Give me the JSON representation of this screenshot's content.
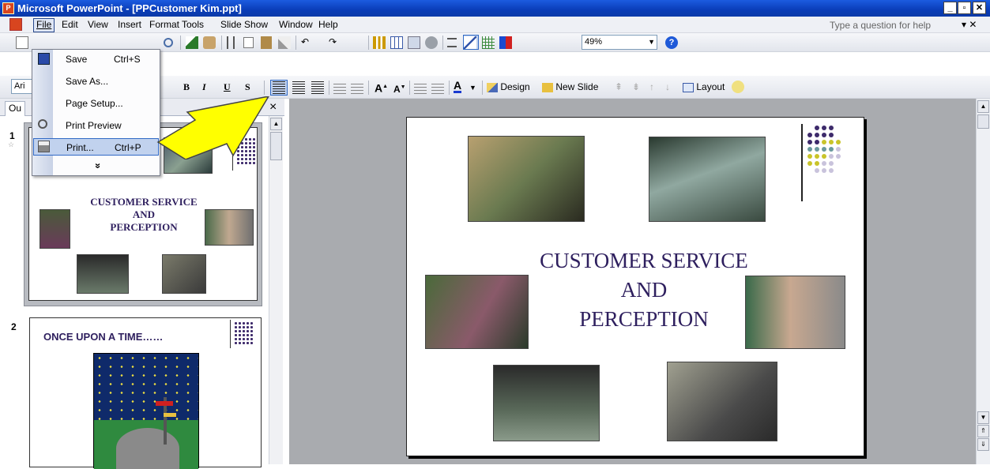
{
  "titlebar": {
    "title": "Microsoft PowerPoint - [PPCustomer  Kim.ppt]",
    "min": "_",
    "restore": "▫",
    "close": "✕"
  },
  "menubar": {
    "items": [
      "File",
      "Edit",
      "View",
      "Insert",
      "Format",
      "Tools",
      "Slide Show",
      "Window",
      "Help"
    ],
    "help_placeholder": "Type a question for help",
    "close_doc": "▾ ✕"
  },
  "toolbar_standard": {
    "zoom": "49%"
  },
  "toolbar_formatting": {
    "font_partial": "Ari",
    "bold": "B",
    "italic": "I",
    "underline": "U",
    "shadow": "S",
    "design": "Design",
    "new_slide": "New Slide",
    "layout": "Layout"
  },
  "outline_tabs": {
    "outline_partial": "Ou",
    "close": "×"
  },
  "file_menu": {
    "items": [
      {
        "label": "Save",
        "shortcut": "Ctrl+S"
      },
      {
        "label": "Save As...",
        "shortcut": ""
      },
      {
        "label": "Page Setup...",
        "shortcut": ""
      },
      {
        "label": "Print Preview",
        "shortcut": ""
      },
      {
        "label": "Print...",
        "shortcut": "Ctrl+P"
      }
    ],
    "expand": "»"
  },
  "thumbnails": [
    {
      "number": "1",
      "line1": "CUSTOMER SERVICE",
      "line2": "AND",
      "line3": "PERCEPTION"
    },
    {
      "number": "2",
      "title": "ONCE UPON A TIME……"
    }
  ],
  "slide": {
    "line1": "CUSTOMER SERVICE",
    "line2": "AND",
    "line3": "PERCEPTION"
  },
  "colors": {
    "title_text": "#2e1f5e",
    "dots_purple": "#3d2a6b",
    "dots_yellow": "#c9c42a",
    "dots_teal": "#6b9a9e",
    "dots_lavender": "#c9c3dc",
    "arrow_yellow": "#ffff00"
  }
}
